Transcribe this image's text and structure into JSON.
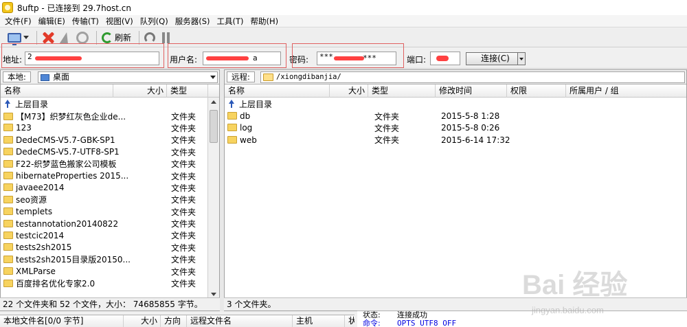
{
  "window": {
    "title": "8uftp - 已连接到 29.7host.cn"
  },
  "menu": [
    {
      "label": "文件(F)"
    },
    {
      "label": "编辑(E)"
    },
    {
      "label": "传输(T)"
    },
    {
      "label": "视图(V)"
    },
    {
      "label": "队列(Q)"
    },
    {
      "label": "服务器(S)"
    },
    {
      "label": "工具(T)"
    },
    {
      "label": "帮助(H)"
    }
  ],
  "toolbar": {
    "refresh_label": "刷新"
  },
  "connection": {
    "address_label": "地址:",
    "address_value": "2",
    "user_label": "用户名:",
    "user_value": "",
    "user_tail": "a",
    "password_label": "密码:",
    "password_value": "***",
    "password_tail": "***",
    "port_label": "端口:",
    "connect_label": "连接(C)"
  },
  "local": {
    "tag": "本地:",
    "path": "桌面",
    "columns": {
      "name": "名称",
      "size": "大小",
      "type": "类型"
    },
    "up_label": "上层目录",
    "items": [
      {
        "name": "【M73】织梦红灰色企业de...",
        "type": "文件夹"
      },
      {
        "name": "123",
        "type": "文件夹"
      },
      {
        "name": "DedeCMS-V5.7-GBK-SP1",
        "type": "文件夹"
      },
      {
        "name": "DedeCMS-V5.7-UTF8-SP1",
        "type": "文件夹"
      },
      {
        "name": "F22-织梦蓝色搬家公司模板",
        "type": "文件夹"
      },
      {
        "name": "hibernateProperties 2015...",
        "type": "文件夹"
      },
      {
        "name": "javaee2014",
        "type": "文件夹"
      },
      {
        "name": "seo资源",
        "type": "文件夹"
      },
      {
        "name": "templets",
        "type": "文件夹"
      },
      {
        "name": "testannotation20140822",
        "type": "文件夹"
      },
      {
        "name": "testcic2014",
        "type": "文件夹"
      },
      {
        "name": "tests2sh2015",
        "type": "文件夹"
      },
      {
        "name": "tests2sh2015目录版20150...",
        "type": "文件夹"
      },
      {
        "name": "XMLParse",
        "type": "文件夹"
      },
      {
        "name": "百度排名优化专家2.0",
        "type": "文件夹"
      }
    ],
    "status": "22 个文件夹和 52 个文件，大小： 74685855 字节。"
  },
  "remote": {
    "tag": "远程:",
    "path": "/xiongdibanjia/",
    "columns": {
      "name": "名称",
      "size": "大小",
      "type": "类型",
      "modified": "修改时间",
      "perms": "权限",
      "owner": "所属用户 / 组"
    },
    "up_label": "上层目录",
    "items": [
      {
        "name": "db",
        "type": "文件夹",
        "modified": "2015-5-8 1:28"
      },
      {
        "name": "log",
        "type": "文件夹",
        "modified": "2015-5-8 0:26"
      },
      {
        "name": "web",
        "type": "文件夹",
        "modified": "2015-6-14 17:32"
      }
    ],
    "status": "3 个文件夹。"
  },
  "queue": {
    "columns": {
      "local_file": "本地文件名[0/0 字节]",
      "size": "大小",
      "direction": "方向",
      "remote_file": "远程文件名",
      "host": "主机",
      "status": "状"
    }
  },
  "log": [
    {
      "key": "状态:",
      "value": "连接成功",
      "kind": "status"
    },
    {
      "key": "命令:",
      "value": "OPTS UTF8 OFF",
      "kind": "cmd"
    }
  ],
  "watermark": {
    "main": "Bai 经验",
    "sub": "jingyan.baidu.com"
  },
  "colors": {
    "annotation_box": "#e06060",
    "redaction": "#ff2020",
    "command_text": "#0000e0"
  }
}
